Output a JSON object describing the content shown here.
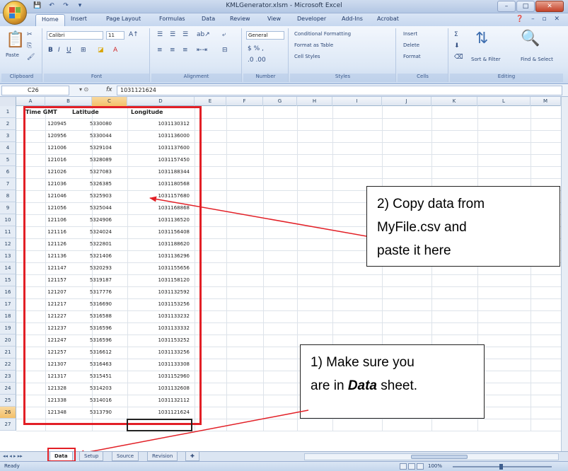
{
  "window": {
    "title": "KMLGenerator.xlsm - Microsoft Excel",
    "controls": [
      "–",
      "□",
      "✕"
    ]
  },
  "ribbon": {
    "tabs": [
      "Home",
      "Insert",
      "Page Layout",
      "Formulas",
      "Data",
      "Review",
      "View",
      "Developer",
      "Add-Ins",
      "Acrobat"
    ],
    "active_tab": "Home",
    "groups": {
      "clipboard": {
        "label": "Clipboard",
        "paste": "Paste"
      },
      "font": {
        "label": "Font",
        "font_name": "Calibri",
        "font_size": "11"
      },
      "alignment": {
        "label": "Alignment"
      },
      "number": {
        "label": "Number",
        "format": "General"
      },
      "styles": {
        "label": "Styles",
        "conditional": "Conditional Formatting",
        "format_table": "Format as Table",
        "cell_styles": "Cell Styles"
      },
      "cells": {
        "label": "Cells",
        "insert": "Insert",
        "delete": "Delete",
        "format": "Format"
      },
      "editing": {
        "label": "Editing",
        "sort": "Sort & Filter",
        "find": "Find & Select"
      }
    }
  },
  "formula_bar": {
    "name_box": "C26",
    "fx": "fx",
    "value": "1031121624"
  },
  "grid": {
    "columns": [
      "A",
      "B",
      "C",
      "D",
      "E",
      "F",
      "G",
      "H",
      "I",
      "J",
      "K",
      "L",
      "M"
    ],
    "selected_column": "C",
    "selected_row": 26,
    "headers": [
      "Time GMT",
      "Latitude",
      "Longitude"
    ],
    "rows": [
      [
        "120945",
        "5330080",
        "1031130312"
      ],
      [
        "120956",
        "5330044",
        "1031136000"
      ],
      [
        "121006",
        "5329104",
        "1031137600"
      ],
      [
        "121016",
        "5328089",
        "1031157450"
      ],
      [
        "121026",
        "5327083",
        "1031188344"
      ],
      [
        "121036",
        "5326385",
        "1031180568"
      ],
      [
        "121046",
        "5325903",
        "1031157680"
      ],
      [
        "121056",
        "5325044",
        "1031168868"
      ],
      [
        "121106",
        "5324906",
        "1031136520"
      ],
      [
        "121116",
        "5324024",
        "1031156408"
      ],
      [
        "121126",
        "5322801",
        "1031188620"
      ],
      [
        "121136",
        "5321406",
        "1031136296"
      ],
      [
        "121147",
        "5320293",
        "1031155656"
      ],
      [
        "121157",
        "5319187",
        "1031158120"
      ],
      [
        "121207",
        "5317776",
        "1031132592"
      ],
      [
        "121217",
        "5316690",
        "1031153256"
      ],
      [
        "121227",
        "5316588",
        "1031133232"
      ],
      [
        "121237",
        "5316596",
        "1031133332"
      ],
      [
        "121247",
        "5316596",
        "1031153252"
      ],
      [
        "121257",
        "5316612",
        "1031133256"
      ],
      [
        "121307",
        "5316463",
        "1031133308"
      ],
      [
        "121317",
        "5315451",
        "1031152960"
      ],
      [
        "121328",
        "5314203",
        "1031132608"
      ],
      [
        "121338",
        "5314016",
        "1031132112"
      ],
      [
        "121348",
        "5313790",
        "1031121624"
      ]
    ]
  },
  "callouts": {
    "copy": [
      "2) Copy data from",
      "MyFile.csv and",
      "paste it here"
    ],
    "sheet": {
      "line1": "1) Make sure you",
      "line2_pre": "are in ",
      "line2_em": "Data",
      "line2_post": " sheet."
    }
  },
  "sheets": {
    "tabs": [
      "Data",
      "Setup",
      "Source",
      "Revision"
    ],
    "active": "Data",
    "nav": "◂◂ ◂ ▸ ▸▸"
  },
  "status_bar": {
    "status": "Ready",
    "zoom": "100%"
  },
  "colors": {
    "accent_red": "#e21f26",
    "ribbon_blue": "#dde8f6",
    "selection_orange": "#f3c06a"
  }
}
